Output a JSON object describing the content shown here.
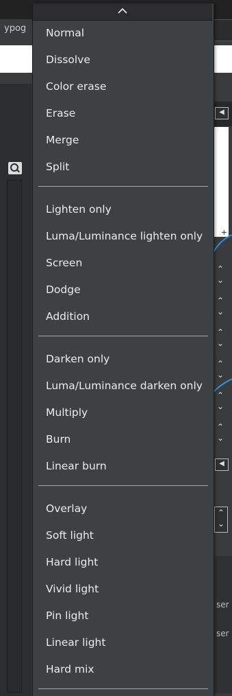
{
  "background": {
    "label": "ypog",
    "plus": "+",
    "side_text_1": "ser",
    "side_text_2": "ser"
  },
  "menu": {
    "groups": [
      [
        "Normal",
        "Dissolve",
        "Color erase",
        "Erase",
        "Merge",
        "Split"
      ],
      [
        "Lighten only",
        "Luma/Luminance lighten only",
        "Screen",
        "Dodge",
        "Addition"
      ],
      [
        "Darken only",
        "Luma/Luminance darken only",
        "Multiply",
        "Burn",
        "Linear burn"
      ],
      [
        "Overlay",
        "Soft light",
        "Hard light",
        "Vivid light",
        "Pin light",
        "Linear light",
        "Hard mix"
      ]
    ]
  },
  "colors": {
    "accent": "#2f8fe0"
  }
}
